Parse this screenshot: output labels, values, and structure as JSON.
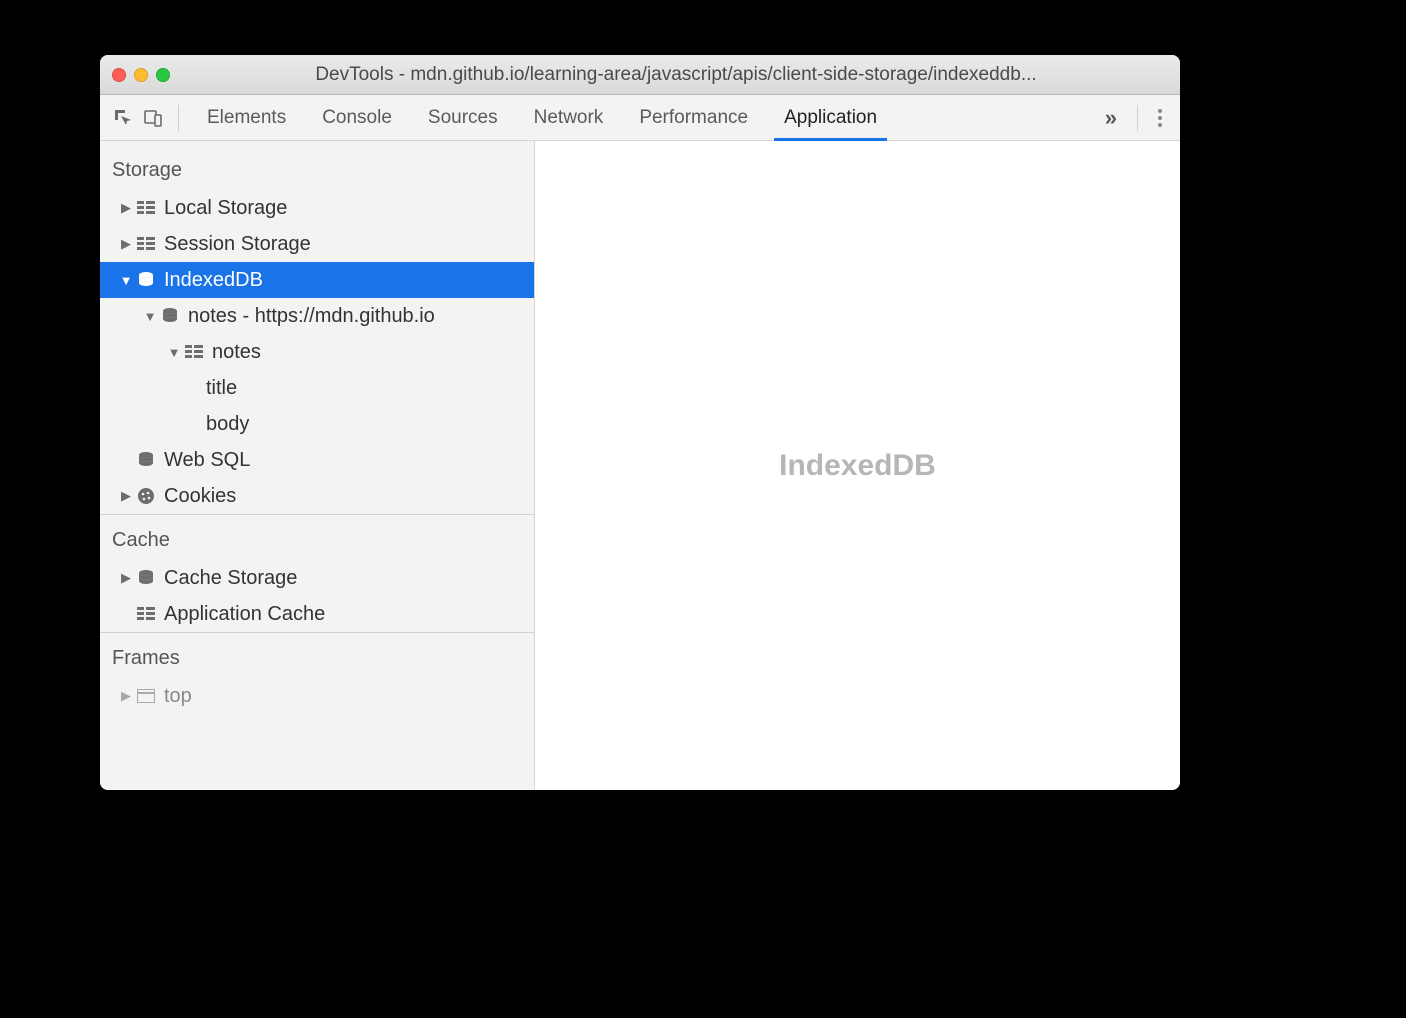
{
  "window": {
    "title": "DevTools - mdn.github.io/learning-area/javascript/apis/client-side-storage/indexeddb..."
  },
  "toolbar": {
    "tabs": [
      {
        "label": "Elements"
      },
      {
        "label": "Console"
      },
      {
        "label": "Sources"
      },
      {
        "label": "Network"
      },
      {
        "label": "Performance"
      },
      {
        "label": "Application"
      }
    ],
    "active_index": 5
  },
  "sidebar": {
    "sections": {
      "storage": {
        "title": "Storage",
        "items": {
          "local_storage": "Local Storage",
          "session_storage": "Session Storage",
          "indexeddb": "IndexedDB",
          "idb_db": "notes - https://mdn.github.io",
          "idb_store": "notes",
          "idb_index_title": "title",
          "idb_index_body": "body",
          "web_sql": "Web SQL",
          "cookies": "Cookies"
        }
      },
      "cache": {
        "title": "Cache",
        "items": {
          "cache_storage": "Cache Storage",
          "app_cache": "Application Cache"
        }
      },
      "frames": {
        "title": "Frames",
        "items": {
          "top": "top"
        }
      }
    }
  },
  "main": {
    "heading": "IndexedDB"
  }
}
